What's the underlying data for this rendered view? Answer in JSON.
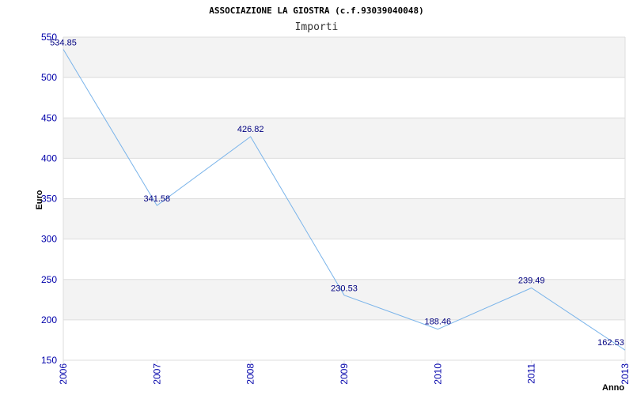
{
  "chart_data": {
    "type": "line",
    "title": "ASSOCIAZIONE LA GIOSTRA (c.f.93039040048)",
    "subtitle": "Importi",
    "xlabel": "Anno",
    "ylabel": "Euro",
    "categories": [
      "2006",
      "2007",
      "2008",
      "2009",
      "2010",
      "2011",
      "2013"
    ],
    "values": [
      534.85,
      341.58,
      426.82,
      230.53,
      188.46,
      239.49,
      162.53
    ],
    "data_labels": [
      "534.85",
      "341.58",
      "426.82",
      "230.53",
      "188.46",
      "239.49",
      "162.53"
    ],
    "yticks": [
      "150",
      "200",
      "250",
      "300",
      "350",
      "400",
      "450",
      "500",
      "550"
    ],
    "ylim": [
      150,
      550
    ],
    "grid": true,
    "colors": {
      "line": "#7ab4ea",
      "band": "#f3f3f3",
      "gridline": "#dddddd",
      "tick_text": "#0000aa",
      "data_label": "#000080"
    }
  }
}
